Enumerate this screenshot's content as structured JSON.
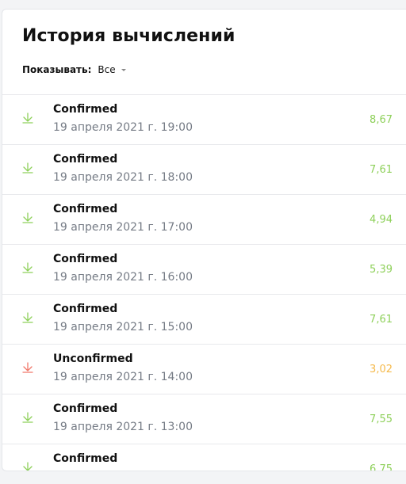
{
  "title": "История вычислений",
  "filter": {
    "label": "Показывать:",
    "value": "Все"
  },
  "colors": {
    "confirmed": "#8ed05a",
    "unconfirmed_icon": "#f0786a",
    "unconfirmed_value": "#f5b94a"
  },
  "rows": [
    {
      "status": "Confirmed",
      "date": "19 апреля 2021 г. 19:00",
      "value": "8,67",
      "state": "confirmed",
      "icon": "download-arrow-icon"
    },
    {
      "status": "Confirmed",
      "date": "19 апреля 2021 г. 18:00",
      "value": "7,61",
      "state": "confirmed",
      "icon": "download-arrow-icon"
    },
    {
      "status": "Confirmed",
      "date": "19 апреля 2021 г. 17:00",
      "value": "4,94",
      "state": "confirmed",
      "icon": "download-arrow-icon"
    },
    {
      "status": "Confirmed",
      "date": "19 апреля 2021 г. 16:00",
      "value": "5,39",
      "state": "confirmed",
      "icon": "download-arrow-icon"
    },
    {
      "status": "Confirmed",
      "date": "19 апреля 2021 г. 15:00",
      "value": "7,61",
      "state": "confirmed",
      "icon": "download-arrow-icon"
    },
    {
      "status": "Unconfirmed",
      "date": "19 апреля 2021 г. 14:00",
      "value": "3,02",
      "state": "unconfirmed",
      "icon": "download-arrow-icon"
    },
    {
      "status": "Confirmed",
      "date": "19 апреля 2021 г. 13:00",
      "value": "7,55",
      "state": "confirmed",
      "icon": "download-arrow-icon"
    },
    {
      "status": "Confirmed",
      "date": "",
      "value": "6,75",
      "state": "confirmed",
      "icon": "download-arrow-icon"
    }
  ]
}
